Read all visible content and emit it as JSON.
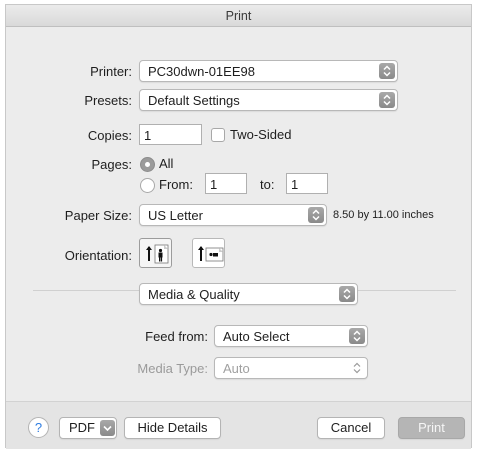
{
  "window": {
    "title": "Print"
  },
  "printer": {
    "label": "Printer:",
    "value": "PC30dwn-01EE98"
  },
  "presets": {
    "label": "Presets:",
    "value": "Default Settings"
  },
  "copies": {
    "label": "Copies:",
    "value": "1",
    "two_sided_label": "Two-Sided",
    "two_sided_checked": false
  },
  "pages": {
    "label": "Pages:",
    "all_label": "All",
    "from_label": "From:",
    "from_value": "1",
    "to_label": "to:",
    "to_value": "1",
    "selected": "All"
  },
  "paper_size": {
    "label": "Paper Size:",
    "value": "US Letter",
    "dimensions": "8.50 by 11.00 inches"
  },
  "orientation": {
    "label": "Orientation:",
    "options": [
      "portrait-icon",
      "landscape-icon"
    ],
    "selected": "portrait"
  },
  "panel": {
    "value": "Media & Quality"
  },
  "feed_from": {
    "label": "Feed from:",
    "value": "Auto Select"
  },
  "media_type": {
    "label": "Media Type:",
    "value": "Auto",
    "enabled": false
  },
  "footer": {
    "help": "?",
    "pdf_label": "PDF",
    "hide_details": "Hide Details",
    "cancel": "Cancel",
    "print": "Print"
  },
  "colors": {
    "help_blue": "#2f7de1",
    "stepper_gray": "#8a8a8a",
    "print_disabled": "#b5b5b5"
  }
}
